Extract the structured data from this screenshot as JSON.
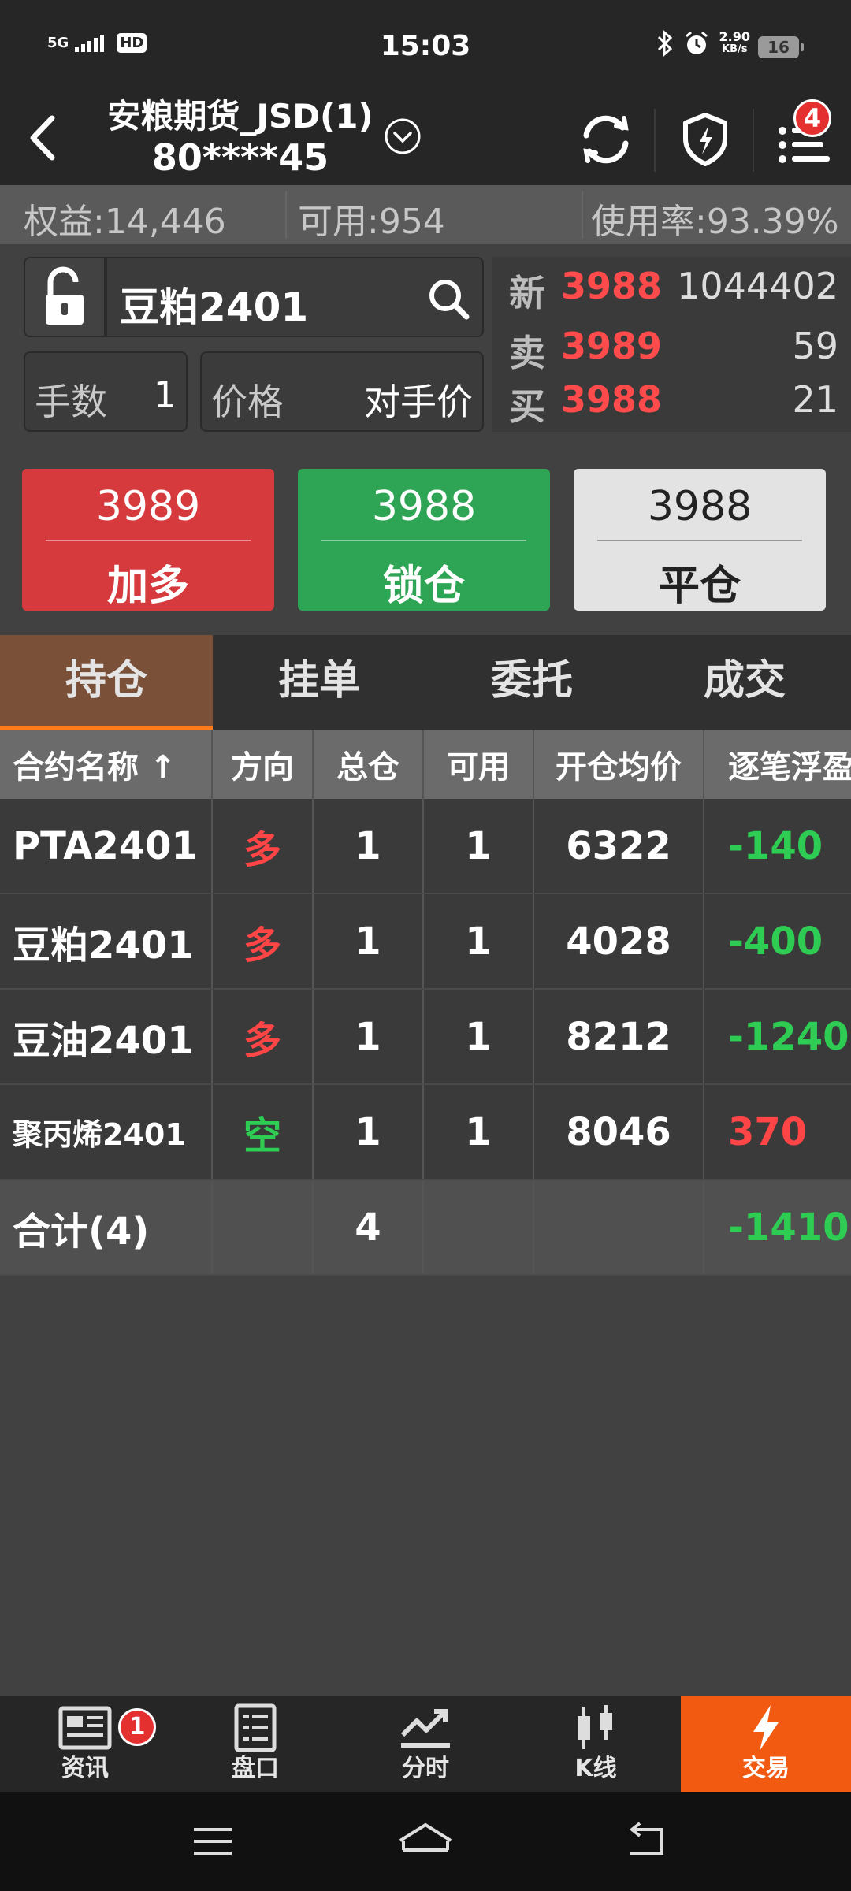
{
  "status_bar": {
    "network": "5G",
    "hd": "HD",
    "time": "15:03",
    "speed_value": "2.90",
    "speed_unit": "KB/s",
    "battery": "16",
    "icons": [
      "bluetooth-icon",
      "alarm-icon"
    ]
  },
  "header": {
    "title": "安粮期货_JSD(1)",
    "account": "80****45",
    "notification_count": "4",
    "icons": [
      "back-icon",
      "chevron-down-icon",
      "refresh-icon",
      "shield-lightning-icon",
      "menu-list-icon"
    ]
  },
  "account_bar": {
    "equity": "权益:14,446",
    "available": "可用:954",
    "usage": "使用率:93.39%"
  },
  "order": {
    "symbol": "豆粕2401",
    "lots_label": "手数",
    "lots_value": "1",
    "price_label": "价格",
    "price_value": "对手价"
  },
  "quote": {
    "last_label": "新",
    "last_price": "3988",
    "volume": "1044402",
    "ask_label": "卖",
    "ask_price": "3989",
    "ask_volume": "59",
    "bid_label": "买",
    "bid_price": "3988",
    "bid_volume": "21"
  },
  "actions": {
    "buy_price": "3989",
    "buy_label": "加多",
    "lock_price": "3988",
    "lock_label": "锁仓",
    "close_price": "3988",
    "close_label": "平仓"
  },
  "tabs": [
    "持仓",
    "挂单",
    "委托",
    "成交"
  ],
  "positions": {
    "columns": [
      "合约名称 ↑",
      "方向",
      "总仓",
      "可用",
      "开仓均价",
      "逐笔浮盈"
    ],
    "rows": [
      {
        "name": "PTA2401",
        "direction": "多",
        "total": "1",
        "available": "1",
        "avg_price": "6322",
        "pnl": "-140"
      },
      {
        "name": "豆粕2401",
        "direction": "多",
        "total": "1",
        "available": "1",
        "avg_price": "4028",
        "pnl": "-400"
      },
      {
        "name": "豆油2401",
        "direction": "多",
        "total": "1",
        "available": "1",
        "avg_price": "8212",
        "pnl": "-1240"
      },
      {
        "name": "聚丙烯2401",
        "direction": "空",
        "total": "1",
        "available": "1",
        "avg_price": "8046",
        "pnl": "370"
      }
    ],
    "total": {
      "name": "合计(4)",
      "total": "4",
      "pnl": "-1410"
    }
  },
  "bottom_nav": {
    "items": [
      "资讯",
      "盘口",
      "分时",
      "K线",
      "交易"
    ],
    "news_badge": "1",
    "active": "交易"
  },
  "colors": {
    "accent": "#f15a10",
    "up_red": "#ff4545",
    "down_green": "#2ecc52",
    "buy_button": "#d73a3d",
    "lock_button": "#2ea554"
  }
}
